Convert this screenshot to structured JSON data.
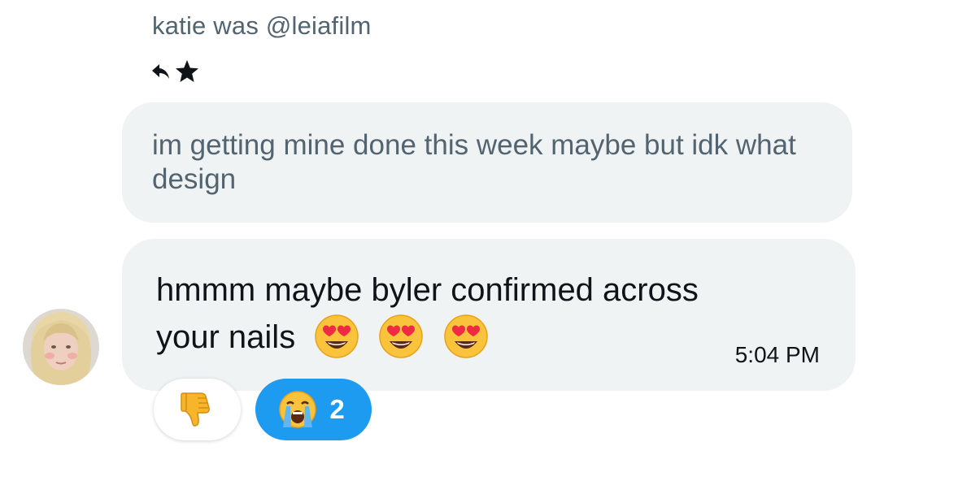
{
  "reply_context": {
    "text": "katie was @leiafilm",
    "icons": [
      "reply-arrow-icon",
      "star-icon"
    ]
  },
  "quoted_message": {
    "text": "im getting mine done this week maybe but idk what design"
  },
  "message": {
    "text": "hmmm maybe byler confirmed across your nails",
    "emojis": [
      "heart-eyes-emoji",
      "heart-eyes-emoji",
      "heart-eyes-emoji"
    ],
    "timestamp": "5:04 PM"
  },
  "reactions": [
    {
      "emoji": "thumbs-down-emoji",
      "count": "",
      "selected": false
    },
    {
      "emoji": "loudly-crying-emoji",
      "count": "2",
      "selected": true
    }
  ],
  "colors": {
    "bubble_bg": "#eff3f4",
    "secondary_text": "#536471",
    "primary_text": "#0f1419",
    "accent": "#1d9bf0"
  }
}
